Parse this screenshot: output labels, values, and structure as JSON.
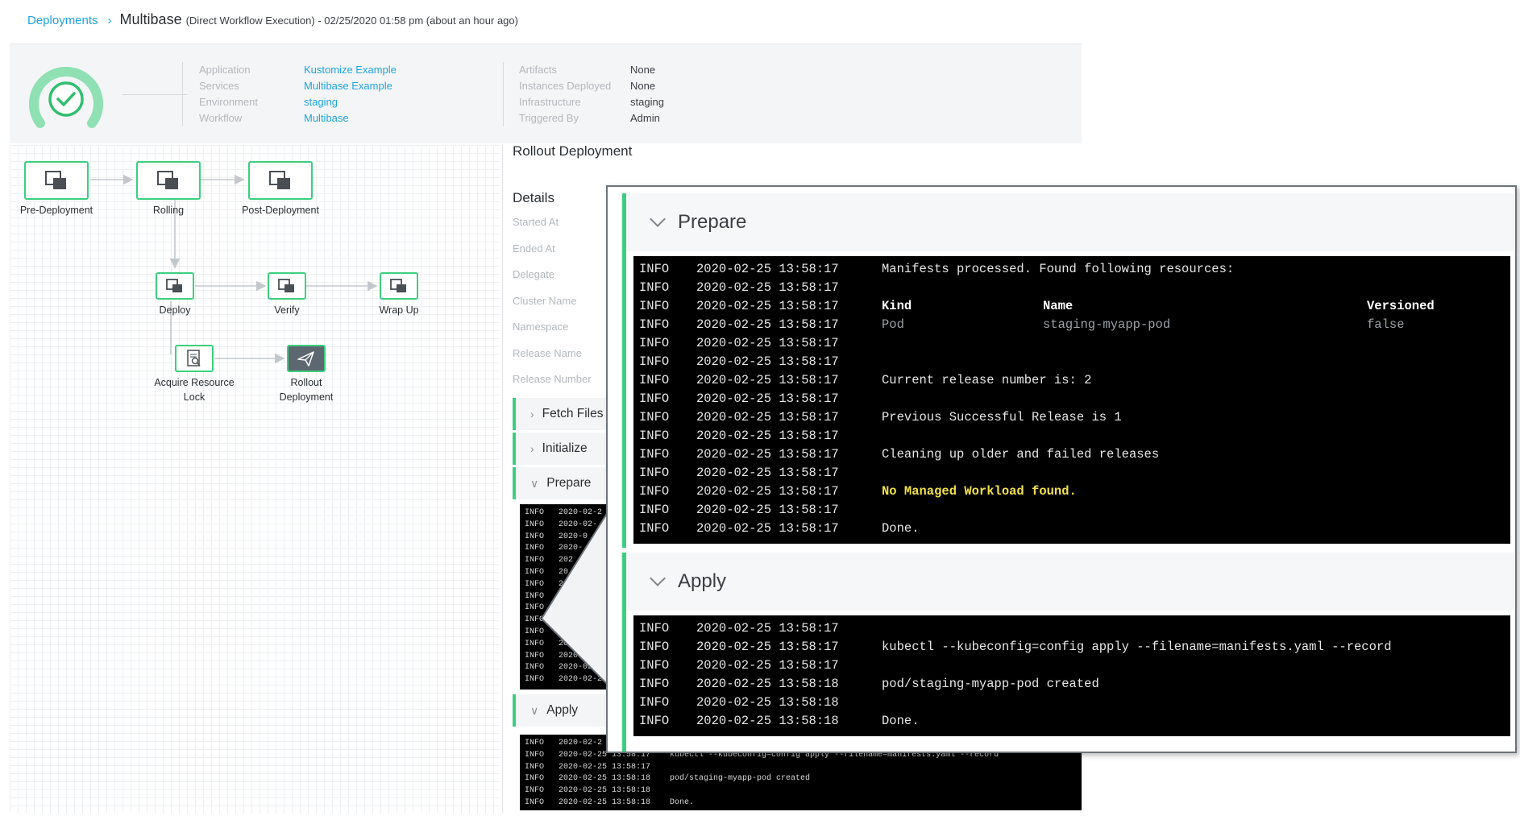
{
  "breadcrumb": {
    "root": "Deployments",
    "title": "Multibase",
    "subtitle": "(Direct Workflow Execution) - 02/25/2020 01:58 pm (about an hour ago)"
  },
  "summary": {
    "left": [
      {
        "key": "Application",
        "value": "Kustomize Example"
      },
      {
        "key": "Services",
        "value": "Multibase Example"
      },
      {
        "key": "Environment",
        "value": "staging"
      },
      {
        "key": "Workflow",
        "value": "Multibase"
      }
    ],
    "right": [
      {
        "key": "Artifacts",
        "value": "None"
      },
      {
        "key": "Instances Deployed",
        "value": "None"
      },
      {
        "key": "Infrastructure",
        "value": "staging"
      },
      {
        "key": "Triggered By",
        "value": "Admin"
      }
    ]
  },
  "workflow": {
    "pre_deployment": "Pre-Deployment",
    "rolling": "Rolling",
    "post_deployment": "Post-Deployment",
    "deploy": "Deploy",
    "verify": "Verify",
    "wrap_up": "Wrap Up",
    "acquire_lock_line1": "Acquire Resource",
    "acquire_lock_line2": "Lock",
    "rollout_line1": "Rollout",
    "rollout_line2": "Deployment"
  },
  "details": {
    "title": "Rollout Deployment",
    "heading": "Details",
    "fields": [
      "Started At",
      "Ended At",
      "Delegate",
      "Cluster Name",
      "Namespace",
      "Release Name",
      "Release Number"
    ],
    "sections": [
      "Fetch Files",
      "Initialize",
      "Prepare",
      "Apply"
    ]
  },
  "mini_prepare_log": [
    "INFO   2020-02-2",
    "INFO   2020-02-",
    "INFO   2020-0",
    "INFO   2020-",
    "INFO   202",
    "INFO   20",
    "INFO   2",
    "INFO",
    "INFO",
    "INFO",
    "INFO   2",
    "INFO   2020-",
    "INFO   2020-02-",
    "INFO   2020-02-2",
    "INFO   2020-02-2"
  ],
  "mini_apply_log": [
    "INFO   2020-02-2",
    "INFO   2020-02-25 13:58:17    kubectl --kubeconfig=config apply --filename=manifests.yaml --record",
    "INFO   2020-02-25 13:58:17",
    "INFO   2020-02-25 13:58:18    pod/staging-myapp-pod created",
    "INFO   2020-02-25 13:58:18",
    "INFO   2020-02-25 13:58:18    Done."
  ],
  "zoom": {
    "prepare": {
      "title": "Prepare",
      "rows": [
        {
          "level": "INFO",
          "ts": "2020-02-25 13:58:17",
          "msg": "Manifests processed. Found following resources:"
        },
        {
          "level": "INFO",
          "ts": "2020-02-25 13:58:17",
          "msg": ""
        },
        {
          "level": "INFO",
          "ts": "2020-02-25 13:58:17",
          "msg": "Kind",
          "c2": "Name",
          "c3": "Versioned",
          "style": "bold"
        },
        {
          "level": "INFO",
          "ts": "2020-02-25 13:58:17",
          "msg": "Pod",
          "c2": "staging-myapp-pod",
          "c3": "false",
          "style": "dim"
        },
        {
          "level": "INFO",
          "ts": "2020-02-25 13:58:17",
          "msg": ""
        },
        {
          "level": "INFO",
          "ts": "2020-02-25 13:58:17",
          "msg": ""
        },
        {
          "level": "INFO",
          "ts": "2020-02-25 13:58:17",
          "msg": "Current release number is: 2"
        },
        {
          "level": "INFO",
          "ts": "2020-02-25 13:58:17",
          "msg": ""
        },
        {
          "level": "INFO",
          "ts": "2020-02-25 13:58:17",
          "msg": "Previous Successful Release is 1"
        },
        {
          "level": "INFO",
          "ts": "2020-02-25 13:58:17",
          "msg": ""
        },
        {
          "level": "INFO",
          "ts": "2020-02-25 13:58:17",
          "msg": "Cleaning up older and failed releases"
        },
        {
          "level": "INFO",
          "ts": "2020-02-25 13:58:17",
          "msg": ""
        },
        {
          "level": "INFO",
          "ts": "2020-02-25 13:58:17",
          "msg": "No Managed Workload found.",
          "style": "yellow"
        },
        {
          "level": "INFO",
          "ts": "2020-02-25 13:58:17",
          "msg": ""
        },
        {
          "level": "INFO",
          "ts": "2020-02-25 13:58:17",
          "msg": "Done."
        }
      ]
    },
    "apply": {
      "title": "Apply",
      "rows": [
        {
          "level": "INFO",
          "ts": "2020-02-25 13:58:17",
          "msg": ""
        },
        {
          "level": "INFO",
          "ts": "2020-02-25 13:58:17",
          "msg": "kubectl --kubeconfig=config apply --filename=manifests.yaml --record"
        },
        {
          "level": "INFO",
          "ts": "2020-02-25 13:58:17",
          "msg": ""
        },
        {
          "level": "INFO",
          "ts": "2020-02-25 13:58:18",
          "msg": "pod/staging-myapp-pod created"
        },
        {
          "level": "INFO",
          "ts": "2020-02-25 13:58:18",
          "msg": ""
        },
        {
          "level": "INFO",
          "ts": "2020-02-25 13:58:18",
          "msg": "Done."
        }
      ]
    }
  },
  "colors": {
    "accent": "#1ea5e0",
    "success": "#3ccf7f",
    "warning_text": "#f1e04b",
    "selected_node": "#5d6770"
  },
  "icons": {
    "status": "check-circle-icon",
    "step": "step-squares-icon",
    "lock": "document-search-icon",
    "rollout": "paper-plane-icon",
    "section_collapsed": "chevron-right-icon",
    "section_expanded": "chevron-down-icon"
  }
}
